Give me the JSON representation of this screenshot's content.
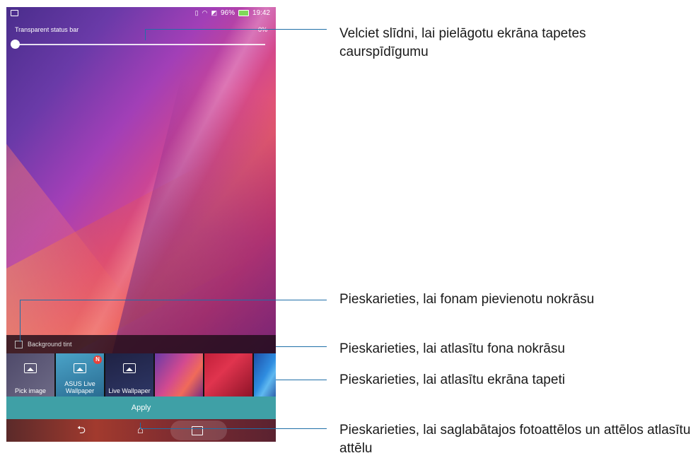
{
  "status_bar": {
    "battery": "96%",
    "time": "19:42",
    "icons": [
      "gallery-icon",
      "vibrate-icon",
      "wifi-icon",
      "no-sim-icon",
      "battery-icon"
    ]
  },
  "slider": {
    "label": "Transparent status bar",
    "value": "0%",
    "level": 0
  },
  "tint": {
    "label": "Background tint",
    "checked": false
  },
  "thumbnails": {
    "pick_image": "Pick image",
    "asus_live": "ASUS Live Wallpaper",
    "asus_badge": "N",
    "live_wallpaper": "Live Wallpaper"
  },
  "apply": {
    "label": "Apply"
  },
  "nav": {
    "back": "back-icon",
    "home": "home-icon",
    "recent": "recent-apps-icon"
  },
  "callouts": {
    "slider": "Velciet slīdni, lai pielāgotu ekrāna tapetes caurspīdīgumu",
    "tint_check": "Pieskarieties, lai fonam pievienotu nokrāsu",
    "tint_color": "Pieskarieties, lai atlasītu fona nokrāsu",
    "wallpaper": "Pieskarieties, lai atlasītu ekrāna tapeti",
    "gallery": "Pieskarieties, lai saglabātajos fotoattēlos un attēlos atlasītu attēlu"
  },
  "colors": {
    "callout_line": "#1f6fa8",
    "apply_bar": "#3fa0a6"
  }
}
